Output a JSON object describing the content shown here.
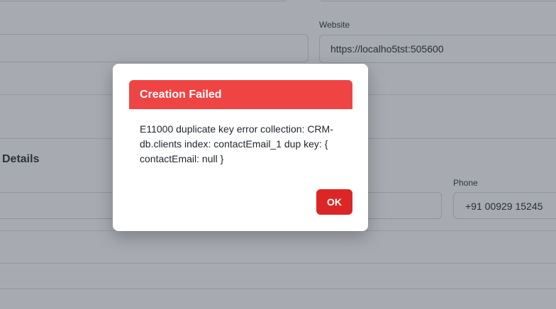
{
  "form": {
    "website": {
      "label": "Website",
      "value": "https://localho5tst:505600"
    },
    "section_heading": "Details",
    "phone": {
      "label": "Phone",
      "value": "+91 00929 15245"
    }
  },
  "dialog": {
    "title": "Creation Failed",
    "message": "E11000 duplicate key error collection: CRM-db.clients index: contactEmail_1 dup key: { contactEmail: null }",
    "ok_label": "OK"
  },
  "colors": {
    "overlay": "#a7aab1",
    "header": "#ef4444",
    "ok_button": "#dc2626"
  }
}
